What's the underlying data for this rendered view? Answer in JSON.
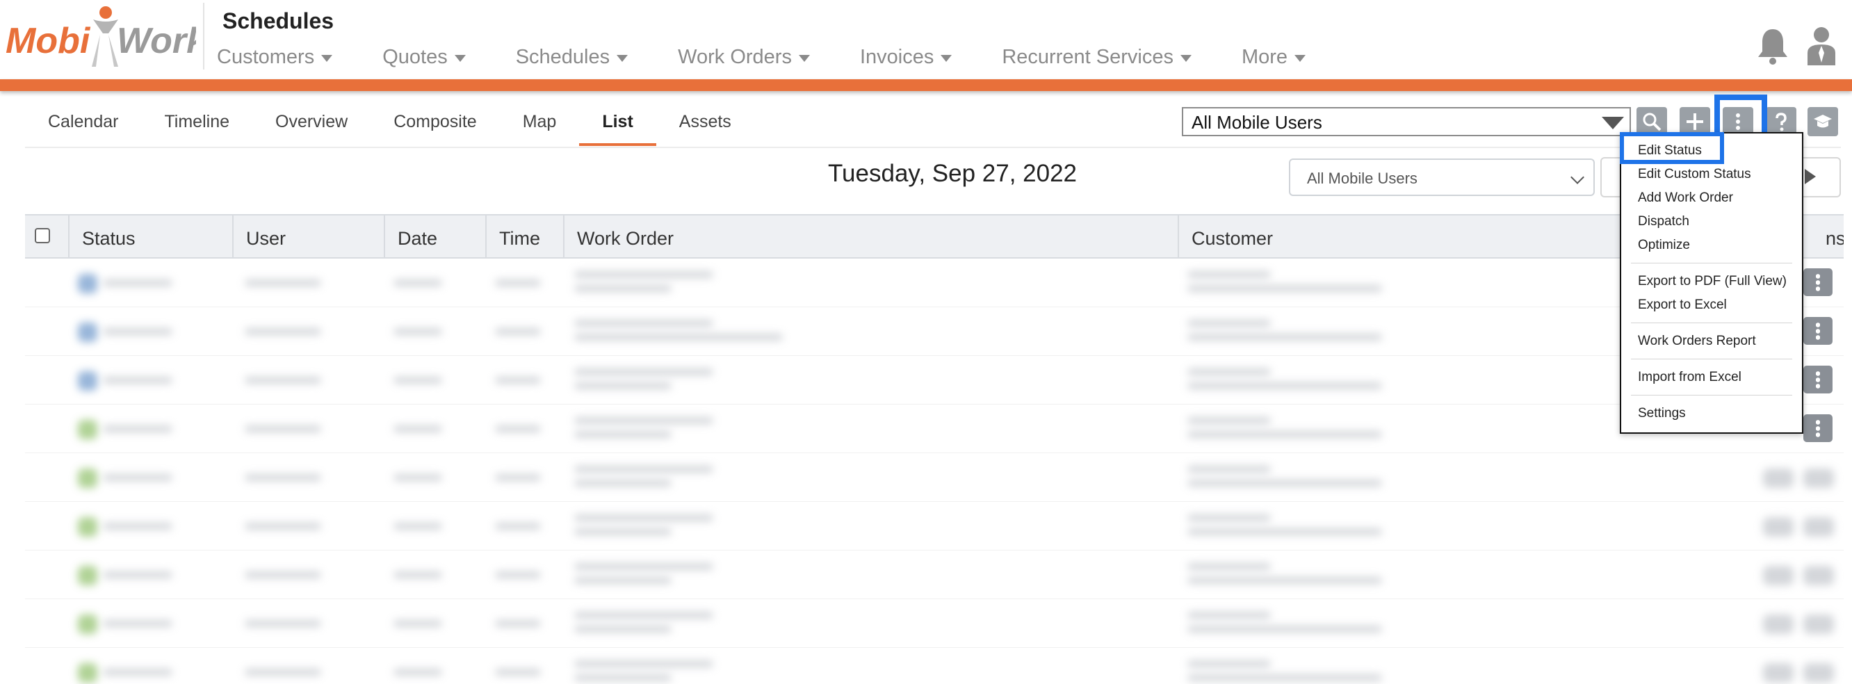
{
  "header": {
    "logo_text": "MobiWork",
    "app_title": "Schedules",
    "nav": [
      {
        "label": "Customers"
      },
      {
        "label": "Quotes"
      },
      {
        "label": "Schedules"
      },
      {
        "label": "Work Orders"
      },
      {
        "label": "Invoices"
      },
      {
        "label": "Recurrent Services"
      },
      {
        "label": "More"
      }
    ],
    "accent_color": "#e8703a"
  },
  "subtabs": [
    {
      "label": "Calendar",
      "active": false
    },
    {
      "label": "Timeline",
      "active": false
    },
    {
      "label": "Overview",
      "active": false
    },
    {
      "label": "Composite",
      "active": false
    },
    {
      "label": "Map",
      "active": false
    },
    {
      "label": "List",
      "active": true
    },
    {
      "label": "Assets",
      "active": false
    }
  ],
  "toolbar": {
    "user_filter_value": "All Mobile Users",
    "icons": [
      "search-icon",
      "plus-icon",
      "more-vertical-icon",
      "help-icon",
      "graduation-cap-icon"
    ]
  },
  "date_row": {
    "date": "Tuesday, Sep 27, 2022",
    "user_filter_value": "All Mobile Users"
  },
  "table": {
    "columns": [
      "Status",
      "User",
      "Date",
      "Time",
      "Work Order",
      "Customer"
    ],
    "actions_column_tail": "ns",
    "row_status_colors": [
      "blue",
      "blue",
      "blue",
      "green",
      "green",
      "green",
      "green",
      "green",
      "green"
    ]
  },
  "dropdown_menu": {
    "items": [
      {
        "label": "Edit Status",
        "group": 1
      },
      {
        "label": "Edit Custom Status",
        "group": 1
      },
      {
        "label": "Add Work Order",
        "group": 1
      },
      {
        "label": "Dispatch",
        "group": 1
      },
      {
        "label": "Optimize",
        "group": 1
      },
      {
        "label": "Export to PDF (Full View)",
        "group": 2
      },
      {
        "label": "Export to Excel",
        "group": 2
      },
      {
        "label": "Work Orders Report",
        "group": 3
      },
      {
        "label": "Import from Excel",
        "group": 4
      },
      {
        "label": "Settings",
        "group": 5
      }
    ],
    "highlight_color": "#1e73e8"
  }
}
